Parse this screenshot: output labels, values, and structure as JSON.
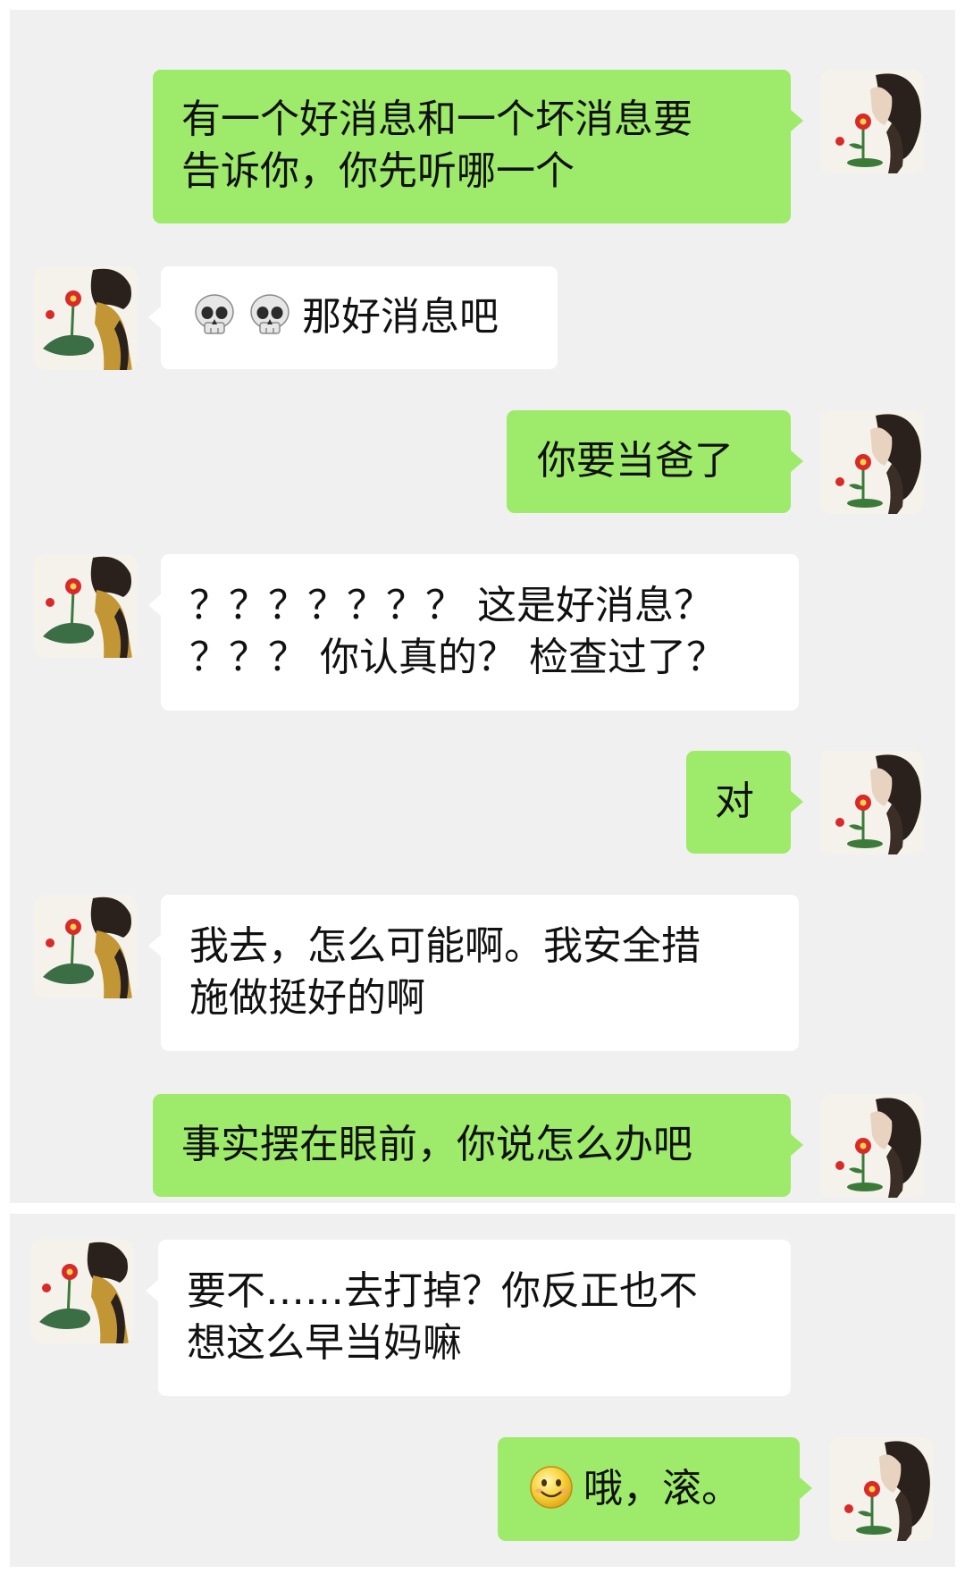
{
  "messages": [
    {
      "side": "sent",
      "lines": [
        "有一个好消息和一个坏消息要",
        "告诉你，你先听哪一个"
      ]
    },
    {
      "side": "recv",
      "icons": [
        "skull-icon",
        "skull-icon"
      ],
      "text": "那好消息吧"
    },
    {
      "side": "sent",
      "text": "你要当爸了"
    },
    {
      "side": "recv",
      "lines": [
        "？？？？？？？ 这是好消息？",
        "？？？ 你认真的？ 检查过了？"
      ]
    },
    {
      "side": "sent",
      "text": "对"
    },
    {
      "side": "recv",
      "lines": [
        "我去，怎么可能啊。我安全措",
        "施做挺好的啊"
      ]
    },
    {
      "side": "sent",
      "text": "事实摆在眼前，你说怎么办吧"
    },
    {
      "side": "recv",
      "lines": [
        "要不……去打掉？你反正也不",
        "想这么早当妈嘛"
      ]
    },
    {
      "side": "sent",
      "icons": [
        "smile-emoji-icon"
      ],
      "text": "哦，滚。"
    }
  ],
  "colors": {
    "sent_bubble": "#9eea6a",
    "received_bubble": "#ffffff",
    "chat_background": "#f0f0f0"
  }
}
